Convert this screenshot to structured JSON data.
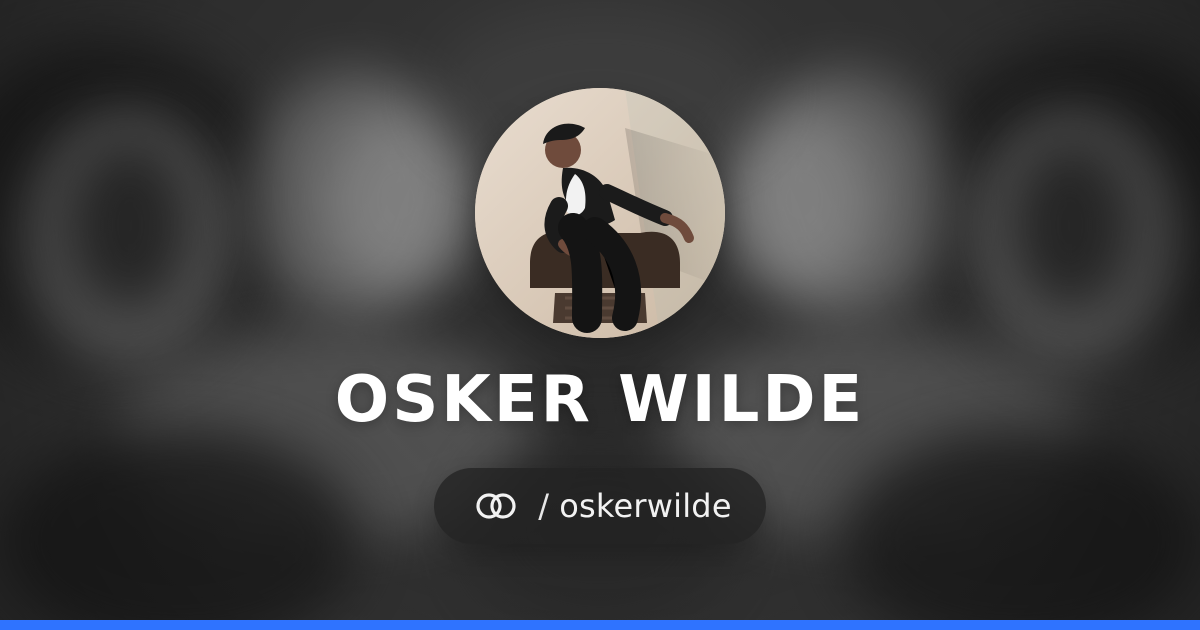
{
  "profile": {
    "name": "OSKER WILDE",
    "handle": "oskerwilde",
    "separator": "/"
  },
  "icons": {
    "link": "linktree-rings-icon"
  },
  "colors": {
    "bottom_bar": "#2f73ff",
    "pill_bg": "#232323"
  }
}
